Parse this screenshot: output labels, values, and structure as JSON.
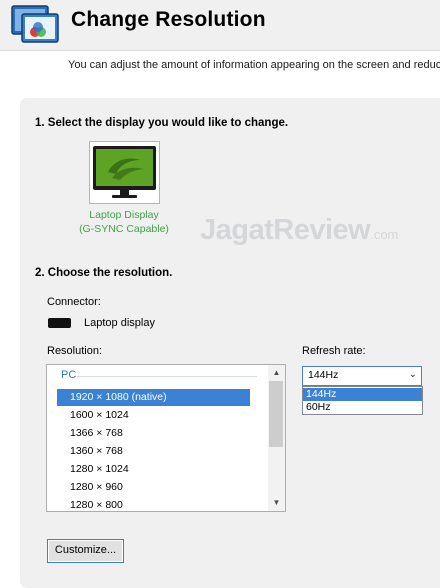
{
  "header": {
    "title": "Change Resolution",
    "description": "You can adjust the amount of information appearing on the screen and reduce f"
  },
  "section1": {
    "heading": "1. Select the display you would like to change.",
    "display": {
      "line1": "Laptop Display",
      "line2": "(G-SYNC Capable)"
    }
  },
  "watermark": {
    "name": "JagatReview",
    "suffix": ".com"
  },
  "section2": {
    "heading": "2. Choose the resolution.",
    "connector_label": "Connector:",
    "connector_value": "Laptop display",
    "resolution_label": "Resolution:",
    "resolution_group": "PC",
    "resolutions": [
      "1920 × 1080 (native)",
      "1600 × 1024",
      "1366 × 768",
      "1360 × 768",
      "1280 × 1024",
      "1280 × 960",
      "1280 × 800"
    ],
    "selected_resolution": "1920 × 1080 (native)",
    "refresh_label": "Refresh rate:",
    "refresh_value": "144Hz",
    "refresh_options": [
      "144Hz",
      "60Hz"
    ],
    "customize_label": "Customize..."
  },
  "colors": {
    "accent_blue": "#3b82d6",
    "display_green": "#3fa34a",
    "nvidia_green": "#76b900"
  },
  "icons": {
    "app": "nvidia-display-settings-icon",
    "display": "nvidia-monitor-icon",
    "connector": "laptop-display-icon"
  }
}
